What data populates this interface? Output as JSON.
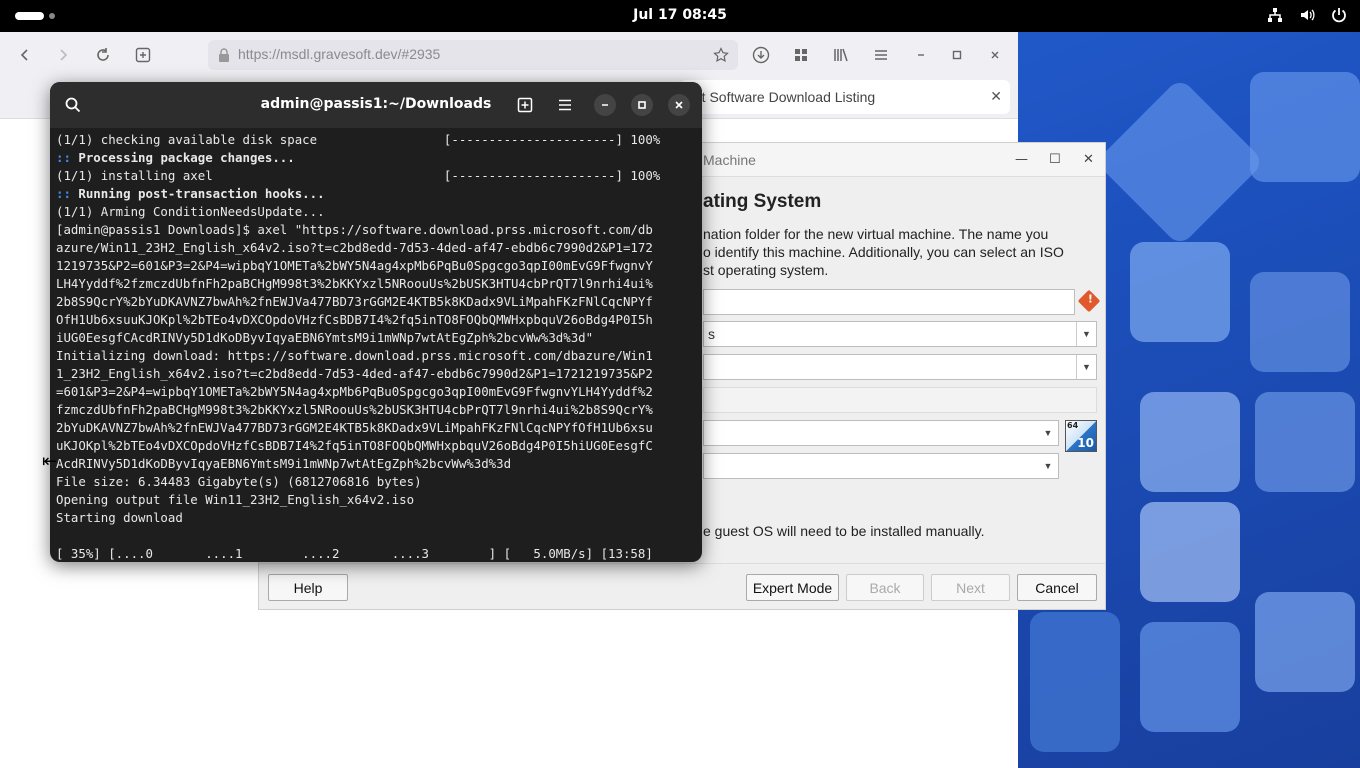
{
  "topbar": {
    "clock": "Jul 17  08:45"
  },
  "browser": {
    "url": "https://msdl.gravesoft.dev/#2935",
    "tab_label": "oft Software Download Listing"
  },
  "vbox": {
    "title": "Machine",
    "heading": "ating System",
    "description": [
      "nation folder for the new virtual machine. The name you",
      "o identify this machine. Additionally, you can select an ISO",
      "st operating system."
    ],
    "fields": {
      "folder_value": "s",
      "type_value": "",
      "version_value": ""
    },
    "win_icon": {
      "badge_top": "64",
      "badge_bottom": "10"
    },
    "manual_note": "e guest OS will need to be installed manually.",
    "buttons": {
      "help": "Help",
      "expert": "Expert Mode",
      "back": "Back",
      "next": "Next",
      "cancel": "Cancel"
    }
  },
  "terminal": {
    "title": "admin@passis1:~/Downloads",
    "lines": [
      {
        "text": "(1/1) checking available disk space                 [----------------------] 100%",
        "kind": "normal"
      },
      {
        "text": ":: Processing package changes...",
        "kind": "prefixed"
      },
      {
        "text": "(1/1) installing axel                               [----------------------] 100%",
        "kind": "normal"
      },
      {
        "text": ":: Running post-transaction hooks...",
        "kind": "prefixed"
      },
      {
        "text": "(1/1) Arming ConditionNeedsUpdate...",
        "kind": "normal"
      },
      {
        "text": "[admin@passis1 Downloads]$ axel \"https://software.download.prss.microsoft.com/db",
        "kind": "normal"
      },
      {
        "text": "azure/Win11_23H2_English_x64v2.iso?t=c2bd8edd-7d53-4ded-af47-ebdb6c7990d2&P1=172",
        "kind": "normal"
      },
      {
        "text": "1219735&P2=601&P3=2&P4=wipbqY1OMETa%2bWY5N4ag4xpMb6PqBu0Spgcgo3qpI00mEvG9FfwgnvY",
        "kind": "normal"
      },
      {
        "text": "LH4Yyddf%2fzmczdUbfnFh2paBCHgM998t3%2bKKYxzl5NRoouUs%2bUSK3HTU4cbPrQT7l9nrhi4ui%",
        "kind": "normal"
      },
      {
        "text": "2b8S9QcrY%2bYuDKAVNZ7bwAh%2fnEWJVa477BD73rGGM2E4KTB5k8KDadx9VLiMpahFKzFNlCqcNPYf",
        "kind": "normal"
      },
      {
        "text": "OfH1Ub6xsuuKJOKpl%2bTEo4vDXCOpdoVHzfCsBDB7I4%2fq5inTO8FOQbQMWHxpbquV26oBdg4P0I5h",
        "kind": "normal"
      },
      {
        "text": "iUG0EesgfCAcdRINVy5D1dKoDByvIqyaEBN6YmtsM9i1mWNp7wtAtEgZph%2bcvWw%3d%3d\"",
        "kind": "normal"
      },
      {
        "text": "Initializing download: https://software.download.prss.microsoft.com/dbazure/Win1",
        "kind": "normal"
      },
      {
        "text": "1_23H2_English_x64v2.iso?t=c2bd8edd-7d53-4ded-af47-ebdb6c7990d2&P1=1721219735&P2",
        "kind": "normal"
      },
      {
        "text": "=601&P3=2&P4=wipbqY1OMETa%2bWY5N4ag4xpMb6PqBu0Spgcgo3qpI00mEvG9FfwgnvYLH4Yyddf%2",
        "kind": "normal"
      },
      {
        "text": "fzmczdUbfnFh2paBCHgM998t3%2bKKYxzl5NRoouUs%2bUSK3HTU4cbPrQT7l9nrhi4ui%2b8S9QcrY%",
        "kind": "normal"
      },
      {
        "text": "2bYuDKAVNZ7bwAh%2fnEWJVa477BD73rGGM2E4KTB5k8KDadx9VLiMpahFKzFNlCqcNPYfOfH1Ub6xsu",
        "kind": "normal"
      },
      {
        "text": "uKJOKpl%2bTEo4vDXCOpdoVHzfCsBDB7I4%2fq5inTO8FOQbQMWHxpbquV26oBdg4P0I5hiUG0EesgfC",
        "kind": "normal"
      },
      {
        "text": "AcdRINVy5D1dKoDByvIqyaEBN6YmtsM9i1mWNp7wtAtEgZph%2bcvWw%3d%3d",
        "kind": "normal"
      },
      {
        "text": "File size: 6.34483 Gigabyte(s) (6812706816 bytes)",
        "kind": "normal"
      },
      {
        "text": "Opening output file Win11_23H2_English_x64v2.iso",
        "kind": "normal"
      },
      {
        "text": "Starting download",
        "kind": "normal"
      },
      {
        "text": "",
        "kind": "normal"
      },
      {
        "text": "[ 35%] [....0       ....1        ....2       ....3        ] [   5.0MB/s] [13:58]",
        "kind": "normal"
      }
    ]
  }
}
